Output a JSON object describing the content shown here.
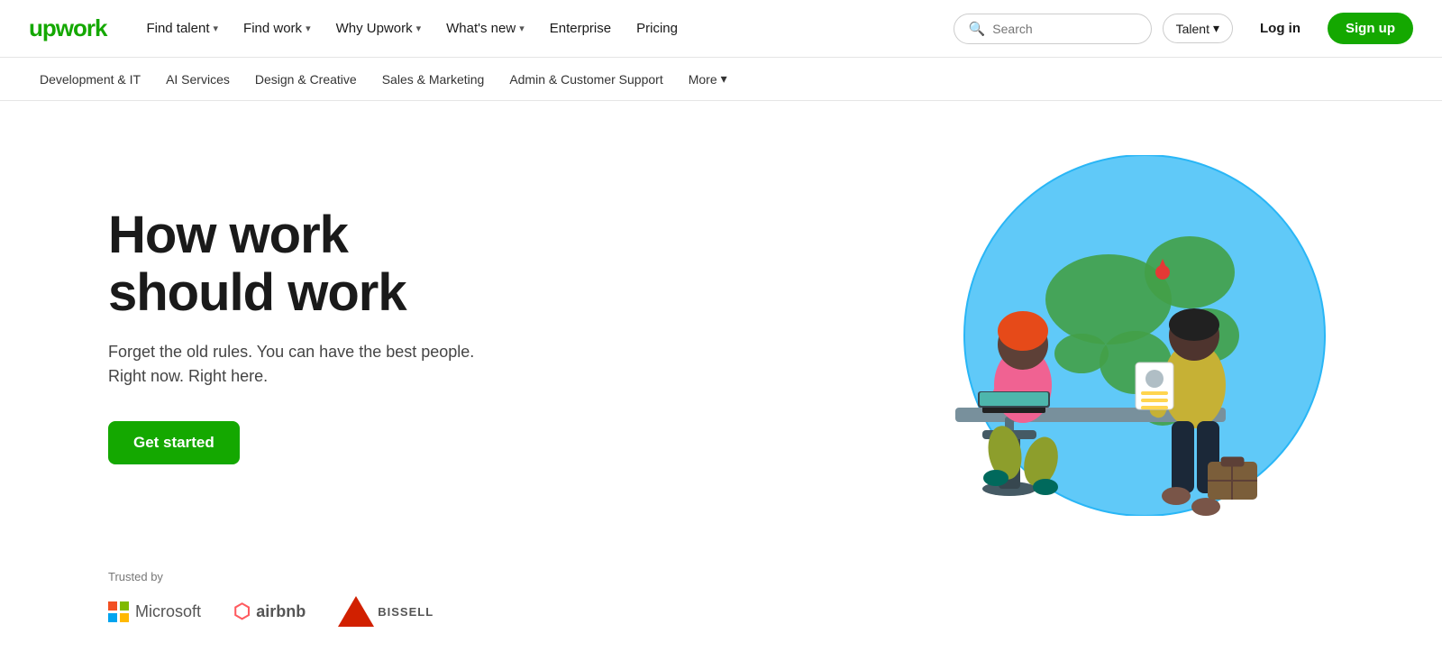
{
  "logo": {
    "text": "upwork"
  },
  "topnav": {
    "links": [
      {
        "label": "Find talent",
        "hasChevron": true
      },
      {
        "label": "Find work",
        "hasChevron": true
      },
      {
        "label": "Why Upwork",
        "hasChevron": true
      },
      {
        "label": "What's new",
        "hasChevron": true
      },
      {
        "label": "Enterprise",
        "hasChevron": false
      },
      {
        "label": "Pricing",
        "hasChevron": false
      }
    ],
    "search": {
      "placeholder": "Search",
      "talent_label": "Talent"
    },
    "login_label": "Log in",
    "signup_label": "Sign up"
  },
  "catnav": {
    "items": [
      {
        "label": "Development & IT"
      },
      {
        "label": "AI Services"
      },
      {
        "label": "Design & Creative"
      },
      {
        "label": "Sales & Marketing"
      },
      {
        "label": "Admin & Customer Support"
      },
      {
        "label": "More",
        "hasChevron": true
      }
    ]
  },
  "hero": {
    "title_line1": "How work",
    "title_line2": "should work",
    "subtitle_line1": "Forget the old rules. You can have the best people.",
    "subtitle_line2": "Right now. Right here.",
    "cta_label": "Get started"
  },
  "trusted": {
    "label": "Trusted by",
    "logos": [
      {
        "name": "Microsoft"
      },
      {
        "name": "airbnb"
      },
      {
        "name": "BISSELL"
      }
    ]
  }
}
